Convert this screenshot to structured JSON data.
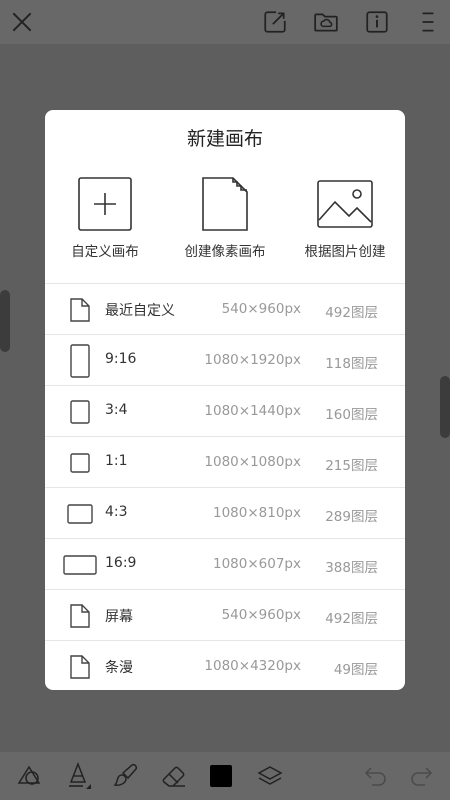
{
  "toolbar": {
    "close_icon": "close-icon",
    "export_icon": "export-icon",
    "folder_icon": "folder-cloud-icon",
    "info_icon": "info-icon",
    "menu_icon": "menu-icon"
  },
  "dialog": {
    "title": "新建画布",
    "options": [
      {
        "label": "自定义画布",
        "icon": "plus-box-icon"
      },
      {
        "label": "创建像素画布",
        "icon": "pixel-file-icon"
      },
      {
        "label": "根据图片创建",
        "icon": "image-icon"
      }
    ],
    "presets": [
      {
        "name": "最近自定义",
        "size": "540×960px",
        "layers": "492图层",
        "icon": "file-icon"
      },
      {
        "name": "9:16",
        "size": "1080×1920px",
        "layers": "118图层",
        "icon": "ratio-9-16-icon"
      },
      {
        "name": "3:4",
        "size": "1080×1440px",
        "layers": "160图层",
        "icon": "ratio-3-4-icon"
      },
      {
        "name": "1:1",
        "size": "1080×1080px",
        "layers": "215图层",
        "icon": "ratio-1-1-icon"
      },
      {
        "name": "4:3",
        "size": "1080×810px",
        "layers": "289图层",
        "icon": "ratio-4-3-icon"
      },
      {
        "name": "16:9",
        "size": "1080×607px",
        "layers": "388图层",
        "icon": "ratio-16-9-icon"
      },
      {
        "name": "屏幕",
        "size": "540×960px",
        "layers": "492图层",
        "icon": "file-icon"
      },
      {
        "name": "条漫",
        "size": "1080×4320px",
        "layers": "49图层",
        "icon": "file-icon"
      }
    ]
  },
  "bottom_toolbar": {
    "tools": [
      "shapes-icon",
      "pen-icon",
      "brush-icon",
      "eraser-icon",
      "color-swatch",
      "layers-icon"
    ],
    "undo_icon": "undo-icon",
    "redo_icon": "redo-icon",
    "current_color": "#000000"
  }
}
